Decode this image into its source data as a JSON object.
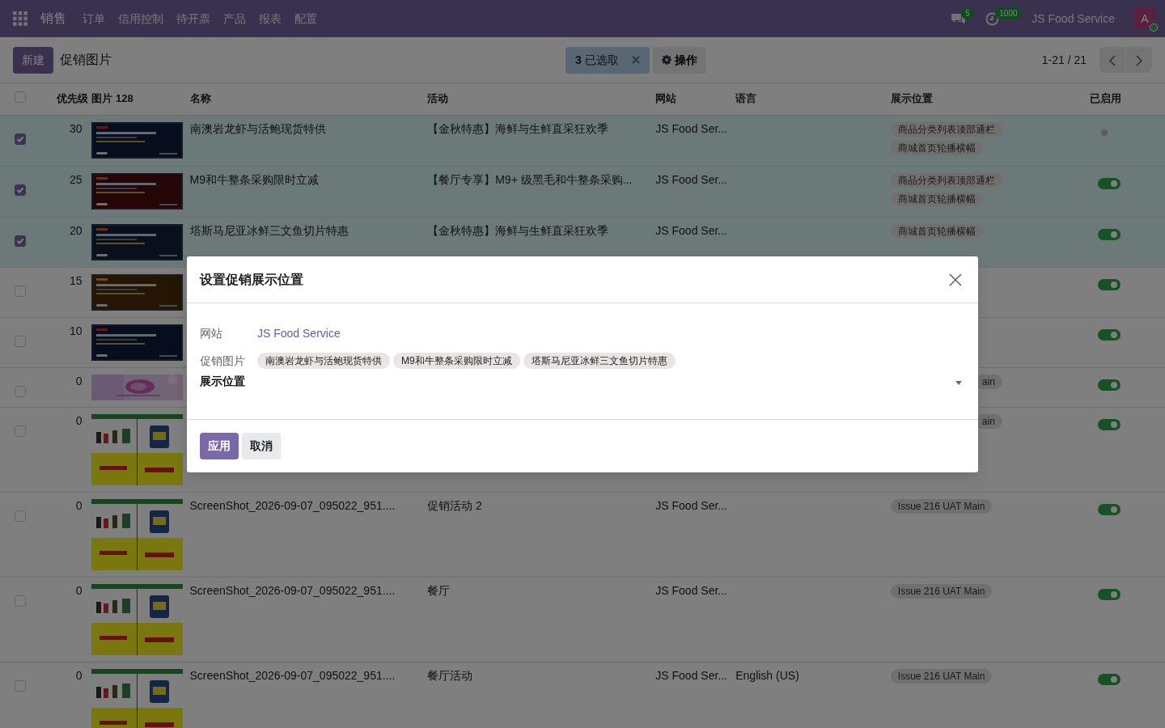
{
  "navbar": {
    "brand": "销售",
    "menus": [
      "订单",
      "信用控制",
      "待开票",
      "产品",
      "报表",
      "配置"
    ],
    "messages_count": "5",
    "activities_count": "1000",
    "company": "JS Food Service",
    "avatar": "A"
  },
  "control_panel": {
    "new_button": "新建",
    "title": "促销图片",
    "selection": "**3** 已选取",
    "actions": "操作",
    "pager": "1-21 / 21"
  },
  "table": {
    "select_all_checked": false,
    "columns": [
      "优先级",
      "图片 128",
      "名称",
      "活动",
      "网站",
      "语言",
      "展示位置",
      "已启用"
    ],
    "rows": [
      {
        "selected": true,
        "priority": "30",
        "name": "南澳岩龙虾与活鲍现货特供",
        "activity": "【金秋特惠】海鲜与生鲜直采狂欢季",
        "website": "JS Food Ser...",
        "tags": [
          "商品分类列表顶部通栏",
          "商城首页轮播横幅"
        ],
        "enabled": false
      },
      {
        "selected": true,
        "priority": "25",
        "name": "M9和牛整条采购限时立减",
        "activity": "【餐厅专享】M9+ 级黑毛和牛整条采购...",
        "website": "JS Food Ser...",
        "tags": [
          "商品分类列表顶部通栏",
          "商城首页轮播横幅"
        ],
        "enabled": true
      },
      {
        "selected": true,
        "priority": "20",
        "name": "塔斯马尼亚冰鲜三文鱼切片特惠",
        "activity": "【金秋特惠】海鲜与生鲜直采狂欢季",
        "website": "JS Food Ser...",
        "tags": [
          "商城首页轮播横幅"
        ],
        "enabled": true
      },
      {
        "selected": false,
        "priority": "15",
        "enabled": true
      },
      {
        "selected": false,
        "priority": "10",
        "enabled": true
      },
      {
        "selected": false,
        "priority": "0",
        "tags": [
          "ain"
        ],
        "enabled": true
      },
      {
        "selected": false,
        "priority": "0",
        "tags": [
          "ain"
        ],
        "enabled": true
      },
      {
        "selected": false,
        "priority": "0",
        "name": "ScreenShot_2026-09-07_095022_951....",
        "activity": "促销活动 2",
        "website": "JS Food Ser...",
        "tags": [
          "Issue 216 UAT Main"
        ],
        "enabled": true
      },
      {
        "selected": false,
        "priority": "0",
        "name": "ScreenShot_2026-09-07_095022_951....",
        "activity": "餐厅",
        "website": "JS Food Ser...",
        "tags": [
          "Issue 216 UAT Main"
        ],
        "enabled": true
      },
      {
        "selected": false,
        "priority": "0",
        "name": "ScreenShot_2026-09-07_095022_951....",
        "activity": "餐厅活动",
        "website": "JS Food Ser...",
        "language": "English (US)",
        "tags": [
          "Issue 216 UAT Main"
        ],
        "enabled": true
      }
    ]
  },
  "dialog": {
    "title": "设置促销展示位置",
    "fields": [
      {
        "kind": "link",
        "label": "网站",
        "required": false,
        "value": "JS Food Service"
      },
      {
        "kind": "tags",
        "label": "促销图片",
        "required": false,
        "tags": [
          "南澳岩龙虾与活鲍现货特供",
          "M9和牛整条采购限时立减",
          "塔斯马尼亚冰鲜三文鱼切片特惠"
        ]
      },
      {
        "kind": "select",
        "label": "展示位置",
        "required": true
      }
    ],
    "buttons": [
      {
        "label": "应用",
        "primary": true
      },
      {
        "label": "取消",
        "primary": false
      }
    ]
  }
}
